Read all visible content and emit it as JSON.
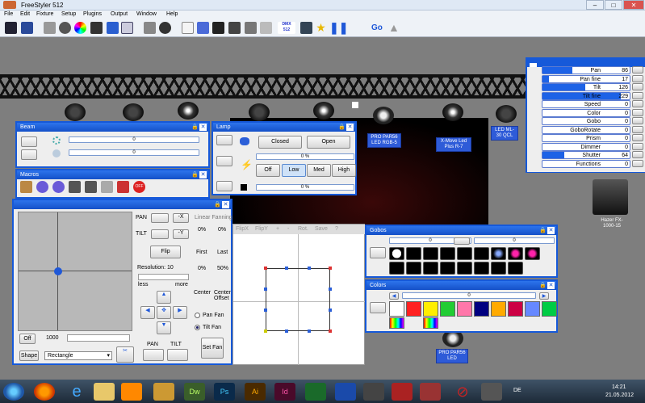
{
  "app": {
    "title": "FreeStyler 512"
  },
  "menu": [
    "File",
    "Edit",
    "Fixture",
    "Setup",
    "Plugins",
    "Output",
    "Window",
    "Help"
  ],
  "toolbar": {
    "dmx_label": "DMX\n512",
    "go_label": "Go"
  },
  "fixtures": [
    "PRO PAR56 LED RGB-5",
    "X-Move Led Plus R-7",
    "LED ML-30 QCL",
    "Hazer FX-1000-15",
    "PRO PAR56 LED"
  ],
  "beam": {
    "title": "Beam",
    "value1": "0",
    "value2": "0"
  },
  "lamp": {
    "title": "Lamp",
    "closed": "Closed",
    "open": "Open",
    "pct1": "0 %",
    "off": "Off",
    "low": "Low",
    "med": "Med",
    "high": "High",
    "pct2": "0 %"
  },
  "macros": {
    "title": "Macros"
  },
  "pantilt": {
    "pan": "PAN",
    "tilt": "TILT",
    "flip": "Flip",
    "resolution": "Resolution: 10",
    "less": "less",
    "more": "more",
    "pan_btn": "PAN",
    "tilt_btn": "TILT",
    "off": "Off",
    "speed": "1000",
    "shape": "Shape",
    "shape_value": "Rectangle",
    "linear_fanning": "Linear Fanning",
    "first_pct": "0%",
    "last_pct": "0%",
    "first": "First",
    "last": "Last",
    "center_pct": "0%",
    "offset_pct": "50%",
    "center": "Center",
    "center_offset": "Center\nOffset",
    "pan_fan": "Pan Fan",
    "tilt_fan": "Tilt Fan",
    "set_fan": "Set Fan",
    "editor_tools": [
      "FlipX",
      "FlipY",
      "+",
      "-",
      "Rot.",
      "Save",
      "?"
    ]
  },
  "gobos": {
    "title": "Gobos",
    "value1": "0",
    "value2": "0"
  },
  "colors": {
    "title": "Colors",
    "value": "0",
    "swatches": [
      "#ffffff",
      "#ff2020",
      "#ffee00",
      "#22cc33",
      "#ff77aa",
      "#000080",
      "#ffaa00",
      "#cc0044",
      "#6688ff",
      "#00cc44"
    ]
  },
  "channels": [
    {
      "name": "Pan",
      "value": "86",
      "fill": 0.34
    },
    {
      "name": "Pan fine",
      "value": "17",
      "fill": 0.07
    },
    {
      "name": "Tilt",
      "value": "126",
      "fill": 0.49
    },
    {
      "name": "Tilt fine",
      "value": "229",
      "fill": 0.9
    },
    {
      "name": "Speed",
      "value": "0",
      "fill": 0
    },
    {
      "name": "Color",
      "value": "0",
      "fill": 0
    },
    {
      "name": "Gobo",
      "value": "0",
      "fill": 0
    },
    {
      "name": "GoboRotate",
      "value": "0",
      "fill": 0
    },
    {
      "name": "Prism",
      "value": "0",
      "fill": 0
    },
    {
      "name": "Dimmer",
      "value": "0",
      "fill": 0
    },
    {
      "name": "Shutter",
      "value": "64",
      "fill": 0.25
    },
    {
      "name": "Functions",
      "value": "0",
      "fill": 0
    }
  ],
  "taskbar": {
    "lang": "DE",
    "time": "14:21",
    "date": "21.05.2012",
    "apps": [
      "Dw",
      "Ps",
      "Ai",
      "Id"
    ]
  },
  "colors_accent": {
    "window_title": "#1659d9",
    "stage": "#7e7e7e"
  }
}
